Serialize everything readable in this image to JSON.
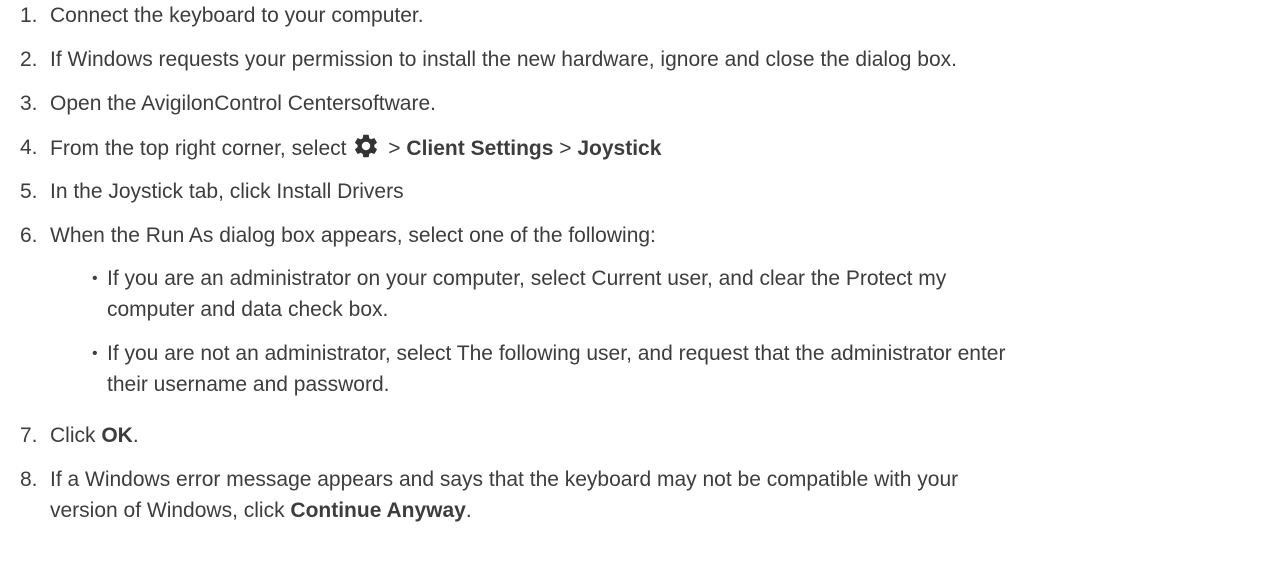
{
  "steps": [
    {
      "num": "1.",
      "text": "Connect the keyboard to your computer."
    },
    {
      "num": "2.",
      "text": "If Windows requests your permission to install the new hardware, ignore and close the dialog box."
    },
    {
      "num": "3.",
      "text": "Open the AvigilonControl Centersoftware."
    },
    {
      "num": "4.",
      "pre": "From the top right corner, select",
      "sep1": " > ",
      "b1": "Client Settings",
      "sep2": " > ",
      "b2": "Joystick",
      "icon": "gear-icon"
    },
    {
      "num": "5.",
      "text": "In the Joystick tab, click Install Drivers"
    },
    {
      "num": "6.",
      "text": "When the Run As dialog box appears, select one of the following:"
    },
    {
      "num": "7.",
      "pre": "Click ",
      "bold": "OK",
      "post": "."
    },
    {
      "num": "8.",
      "line1": "If a Windows error message appears and says that the keyboard may not be compatible with your",
      "line2_pre": "version of Windows, click ",
      "line2_bold": "Continue Anyway",
      "line2_post": "."
    }
  ],
  "bullets": [
    {
      "line1": "If you are an administrator on your computer, select Current user, and clear the Protect my",
      "line2": "computer and data check box."
    },
    {
      "line1": "If you are not an administrator, select The following user, and request that the administrator enter",
      "line2": "their username and password."
    }
  ],
  "bullet_glyph": "•",
  "colors": {
    "text": "#3d3d3d"
  }
}
